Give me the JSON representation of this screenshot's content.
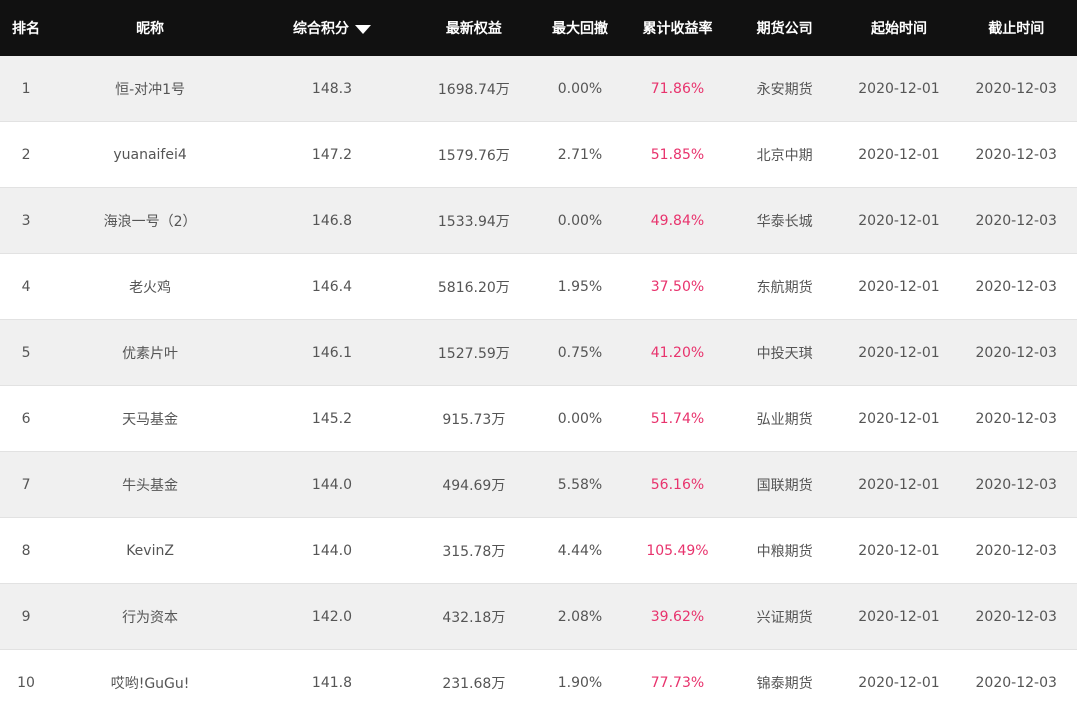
{
  "columns": {
    "rank": "排名",
    "nickname": "昵称",
    "score": "综合积分",
    "equity": "最新权益",
    "drawdown": "最大回撤",
    "return": "累计收益率",
    "broker": "期货公司",
    "start": "起始时间",
    "end": "截止时间",
    "sort_icon": "sort-descending-icon"
  },
  "colors": {
    "header_bg": "#111111",
    "header_text": "#ffffff",
    "row_alt_bg": "#f0f0f0",
    "return_text": "#e8336d"
  },
  "rows": [
    {
      "rank": "1",
      "nickname": "恒-对冲1号",
      "score": "148.3",
      "equity": "1698.74万",
      "drawdown": "0.00%",
      "return": "71.86%",
      "broker": "永安期货",
      "start": "2020-12-01",
      "end": "2020-12-03"
    },
    {
      "rank": "2",
      "nickname": "yuanaifei4",
      "score": "147.2",
      "equity": "1579.76万",
      "drawdown": "2.71%",
      "return": "51.85%",
      "broker": "北京中期",
      "start": "2020-12-01",
      "end": "2020-12-03"
    },
    {
      "rank": "3",
      "nickname": "海浪一号（2）",
      "score": "146.8",
      "equity": "1533.94万",
      "drawdown": "0.00%",
      "return": "49.84%",
      "broker": "华泰长城",
      "start": "2020-12-01",
      "end": "2020-12-03"
    },
    {
      "rank": "4",
      "nickname": "老火鸡",
      "score": "146.4",
      "equity": "5816.20万",
      "drawdown": "1.95%",
      "return": "37.50%",
      "broker": "东航期货",
      "start": "2020-12-01",
      "end": "2020-12-03"
    },
    {
      "rank": "5",
      "nickname": "优素片叶",
      "score": "146.1",
      "equity": "1527.59万",
      "drawdown": "0.75%",
      "return": "41.20%",
      "broker": "中投天琪",
      "start": "2020-12-01",
      "end": "2020-12-03"
    },
    {
      "rank": "6",
      "nickname": "天马基金",
      "score": "145.2",
      "equity": "915.73万",
      "drawdown": "0.00%",
      "return": "51.74%",
      "broker": "弘业期货",
      "start": "2020-12-01",
      "end": "2020-12-03"
    },
    {
      "rank": "7",
      "nickname": "牛头基金",
      "score": "144.0",
      "equity": "494.69万",
      "drawdown": "5.58%",
      "return": "56.16%",
      "broker": "国联期货",
      "start": "2020-12-01",
      "end": "2020-12-03"
    },
    {
      "rank": "8",
      "nickname": "KevinZ",
      "score": "144.0",
      "equity": "315.78万",
      "drawdown": "4.44%",
      "return": "105.49%",
      "broker": "中粮期货",
      "start": "2020-12-01",
      "end": "2020-12-03"
    },
    {
      "rank": "9",
      "nickname": "行为资本",
      "score": "142.0",
      "equity": "432.18万",
      "drawdown": "2.08%",
      "return": "39.62%",
      "broker": "兴证期货",
      "start": "2020-12-01",
      "end": "2020-12-03"
    },
    {
      "rank": "10",
      "nickname": "哎哟!GuGu!",
      "score": "141.8",
      "equity": "231.68万",
      "drawdown": "1.90%",
      "return": "77.73%",
      "broker": "锦泰期货",
      "start": "2020-12-01",
      "end": "2020-12-03"
    }
  ]
}
